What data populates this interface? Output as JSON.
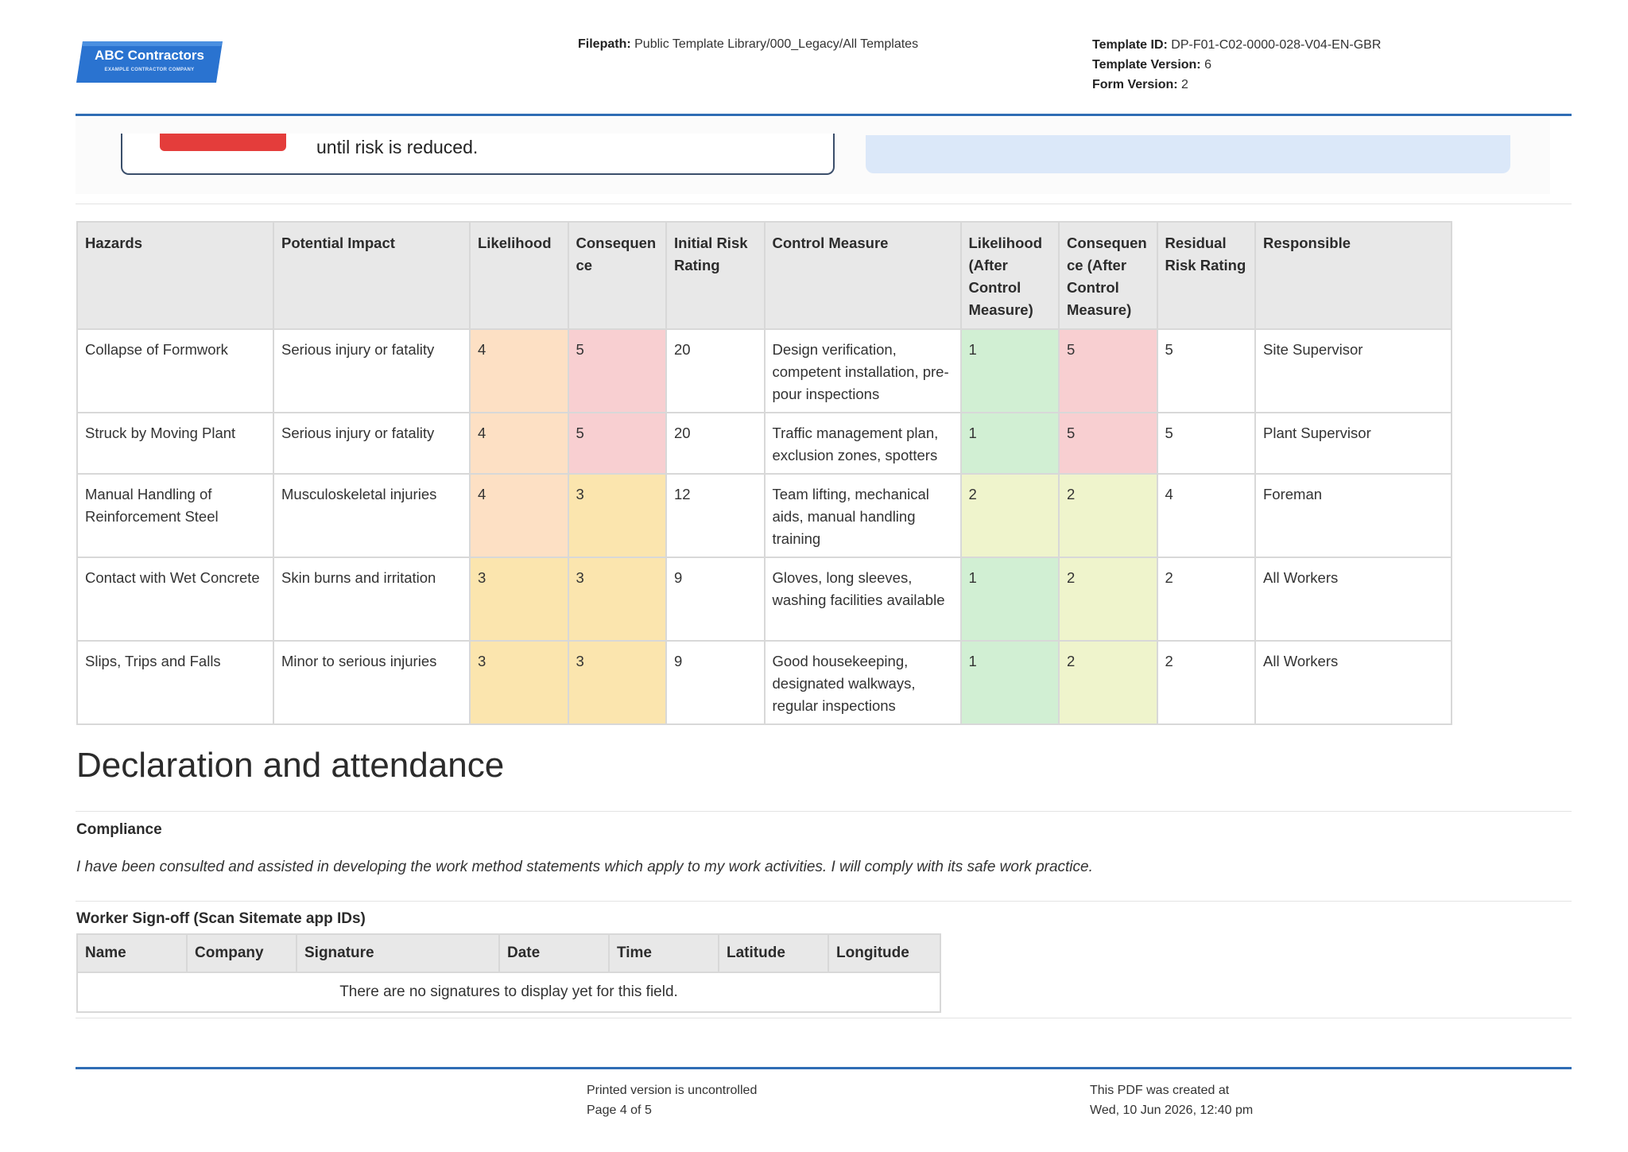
{
  "header": {
    "logo": {
      "name": "ABC Contractors",
      "tagline": "EXAMPLE CONTRACTOR COMPANY",
      "color": "#2a73d0"
    },
    "filepath_label": "Filepath:",
    "filepath_value": "Public Template Library/000_Legacy/All Templates",
    "template_id_label": "Template ID:",
    "template_id_value": "DP-F01-C02-0000-028-V04-EN-GBR",
    "template_version_label": "Template Version:",
    "template_version_value": "6",
    "form_version_label": "Form Version:",
    "form_version_value": "2"
  },
  "cropped_card": {
    "text": "until risk is reduced."
  },
  "risk_table": {
    "headers": [
      [
        "Hazards"
      ],
      [
        "Potential Impact"
      ],
      [
        "Likelihood"
      ],
      [
        "Consequen",
        "ce"
      ],
      [
        "Initial Risk",
        "Rating"
      ],
      [
        "Control Measure"
      ],
      [
        "Likelihood",
        "(After",
        "Control",
        "Measure)"
      ],
      [
        "Consequen",
        "ce (After",
        "Control",
        "Measure)"
      ],
      [
        "Residual",
        "Risk Rating"
      ],
      [
        "Responsible"
      ]
    ],
    "rows": [
      {
        "hazard": "Collapse of Formwork",
        "impact": "Serious injury or fatality",
        "likelihood": "4",
        "consequence": "5",
        "initial": "20",
        "control": "Design verification, competent installation, pre-pour inspections",
        "likelihood_after": "1",
        "consequence_after": "5",
        "residual": "5",
        "responsible": "Site Supervisor"
      },
      {
        "hazard": "Struck by Moving Plant",
        "impact": "Serious injury or fatality",
        "likelihood": "4",
        "consequence": "5",
        "initial": "20",
        "control": "Traffic management plan, exclusion zones, spotters",
        "likelihood_after": "1",
        "consequence_after": "5",
        "residual": "5",
        "responsible": "Plant Supervisor"
      },
      {
        "hazard": "Manual Handling of Reinforcement Steel",
        "impact": "Musculoskeletal injuries",
        "likelihood": "4",
        "consequence": "3",
        "initial": "12",
        "control": "Team lifting, mechanical aids, manual handling training",
        "likelihood_after": "2",
        "consequence_after": "2",
        "residual": "4",
        "responsible": "Foreman"
      },
      {
        "hazard": "Contact with Wet Concrete",
        "impact": "Skin burns and irritation",
        "likelihood": "3",
        "consequence": "3",
        "initial": "9",
        "control": "Gloves, long sleeves, washing facilities available",
        "likelihood_after": "1",
        "consequence_after": "2",
        "residual": "2",
        "responsible": "All Workers"
      },
      {
        "hazard": "Slips, Trips and Falls",
        "impact": "Minor to serious injuries",
        "likelihood": "3",
        "consequence": "3",
        "initial": "9",
        "control": "Good housekeeping, designated walkways, regular inspections",
        "likelihood_after": "1",
        "consequence_after": "2",
        "residual": "2",
        "responsible": "All Workers"
      }
    ]
  },
  "declaration": {
    "title": "Declaration and attendance",
    "compliance_label": "Compliance",
    "compliance_text": "I have been consulted and assisted in developing the work method statements which apply to my work activities. I will comply with its safe work practice.",
    "signoff_label": "Worker Sign-off (Scan Sitemate app IDs)",
    "signoff_columns": [
      "Name",
      "Company",
      "Signature",
      "Date",
      "Time",
      "Latitude",
      "Longitude"
    ],
    "signoff_empty": "There are no signatures to display yet for this field."
  },
  "footer": {
    "uncontrolled": "Printed version is uncontrolled",
    "page": "Page 4 of 5",
    "created_label": "This PDF was created at",
    "created_value": "Wed, 10 Jun 2026, 12:40 pm"
  }
}
